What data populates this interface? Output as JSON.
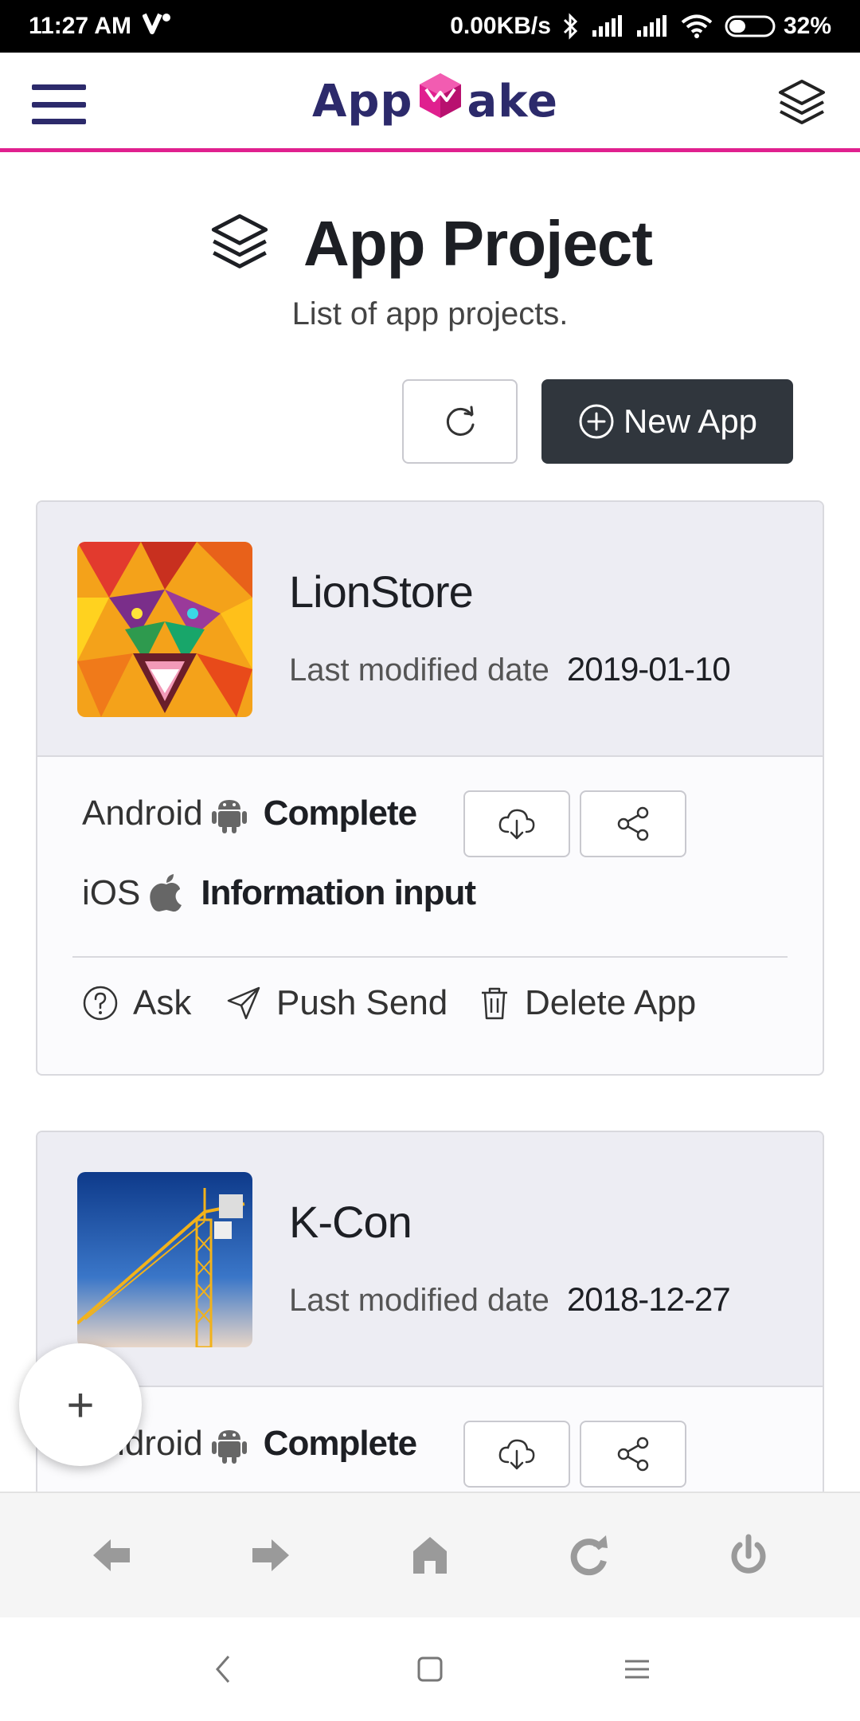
{
  "status_bar": {
    "time": "11:27 AM",
    "network_speed": "0.00KB/s",
    "battery": "32%"
  },
  "header": {
    "logo_text_left": "App",
    "logo_text_right": "ake",
    "brand_color": "#e0208f",
    "logo_color": "#2c2a6b",
    "menu_icon": "hamburger-icon",
    "right_icon": "layers-icon"
  },
  "page": {
    "title": "App Project",
    "subtitle": "List of app projects.",
    "refresh_icon": "refresh-icon",
    "new_app_label": "New App"
  },
  "projects": [
    {
      "name": "LionStore",
      "modified_label": "Last modified date",
      "modified_date": "2019-01-10",
      "platforms": [
        {
          "name": "Android",
          "icon": "android-icon",
          "status": "Complete"
        },
        {
          "name": "iOS",
          "icon": "apple-icon",
          "status": "Information input"
        }
      ],
      "actions": [
        {
          "label": "Ask",
          "icon": "question-icon"
        },
        {
          "label": "Push Send",
          "icon": "send-icon"
        },
        {
          "label": "Delete App",
          "icon": "trash-icon"
        }
      ]
    },
    {
      "name": "K-Con",
      "modified_label": "Last modified date",
      "modified_date": "2018-12-27",
      "platforms": [
        {
          "name": "Android",
          "icon": "android-icon",
          "status": "Complete"
        }
      ]
    }
  ],
  "fab": {
    "label": "+"
  },
  "browser_toolbar": [
    "back-arrow-icon",
    "forward-arrow-icon",
    "home-icon",
    "reload-icon",
    "power-icon"
  ],
  "nav_bar": [
    "back-icon",
    "home-square-icon",
    "recents-menu-icon"
  ]
}
